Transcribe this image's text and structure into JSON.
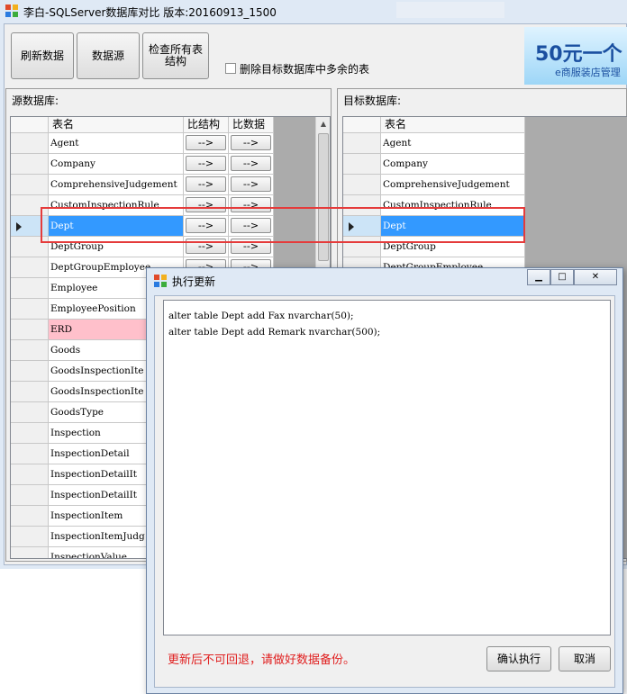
{
  "window": {
    "title": "李白-SQLServer数据库对比 版本:20160913_1500"
  },
  "toolbar": {
    "refresh": "刷新数据",
    "datasource": "数据源",
    "check_line1": "检查所有表",
    "check_line2": "结构",
    "delete_extra": "删除目标数据库中多余的表"
  },
  "ad": {
    "headline": "50元一个",
    "subtext": "e商服装店管理"
  },
  "source": {
    "label": "源数据库:",
    "col_name": "表名",
    "col_struct": "比结构",
    "col_data": "比数据",
    "arrow": "-->",
    "rows": [
      {
        "name": "Agent"
      },
      {
        "name": "Company"
      },
      {
        "name": "ComprehensiveJudgement"
      },
      {
        "name": "CustomInspectionRule"
      },
      {
        "name": "Dept",
        "state": "selected"
      },
      {
        "name": "DeptGroup"
      },
      {
        "name": "DeptGroupEmployee"
      },
      {
        "name": "Employee"
      },
      {
        "name": "EmployeePosition"
      },
      {
        "name": "ERD",
        "state": "pink"
      },
      {
        "name": "Goods"
      },
      {
        "name": "GoodsInspectionIte"
      },
      {
        "name": "GoodsInspectionIte"
      },
      {
        "name": "GoodsType"
      },
      {
        "name": "Inspection"
      },
      {
        "name": "InspectionDetail"
      },
      {
        "name": "InspectionDetailIt"
      },
      {
        "name": "InspectionDetailIt"
      },
      {
        "name": "InspectionItem"
      },
      {
        "name": "InspectionItemJudg"
      },
      {
        "name": "InspectionValue"
      }
    ]
  },
  "target": {
    "label": "目标数据库:",
    "col_name": "表名",
    "rows": [
      {
        "name": "Agent"
      },
      {
        "name": "Company"
      },
      {
        "name": "ComprehensiveJudgement"
      },
      {
        "name": "CustomInspectionRule"
      },
      {
        "name": "Dept",
        "state": "selected"
      },
      {
        "name": "DeptGroup"
      },
      {
        "name": "DeptGroupEmployee"
      }
    ]
  },
  "dialog": {
    "title": "执行更新",
    "sql": "alter table Dept add Fax nvarchar(50);\nalter table Dept add Remark nvarchar(500);",
    "warning": "更新后不可回退，请做好数据备份。",
    "confirm": "确认执行",
    "cancel": "取消"
  }
}
